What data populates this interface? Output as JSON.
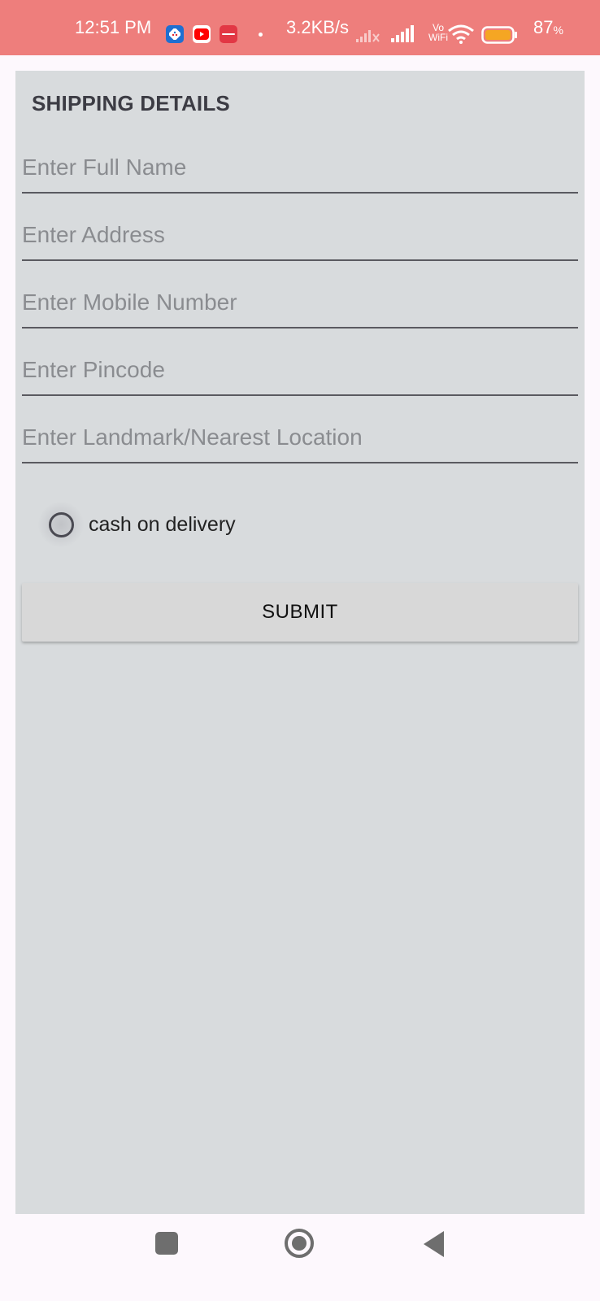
{
  "status_bar": {
    "time": "12:51 PM",
    "net_speed": "3.2KB/s",
    "vowifi_top": "Vo",
    "vowifi_bottom": "WiFi",
    "battery": "87",
    "battery_unit": "%",
    "icons": [
      "dominos-icon",
      "youtube-icon",
      "zomato-icon",
      "signal-icon",
      "wifi-icon",
      "battery-icon"
    ]
  },
  "form": {
    "title": "SHIPPING DETAILS",
    "fields": [
      {
        "placeholder": "Enter Full Name",
        "value": ""
      },
      {
        "placeholder": "Enter Address",
        "value": ""
      },
      {
        "placeholder": "Enter Mobile Number",
        "value": ""
      },
      {
        "placeholder": "Enter Pincode",
        "value": ""
      },
      {
        "placeholder": "Enter Landmark/Nearest Location",
        "value": ""
      }
    ],
    "payment_option": "cash on delivery",
    "submit_label": "SUBMIT"
  },
  "colors": {
    "status_bar": "#ee7e7c",
    "card_background": "#d8dbdd",
    "battery_fill": "#f5a623"
  }
}
